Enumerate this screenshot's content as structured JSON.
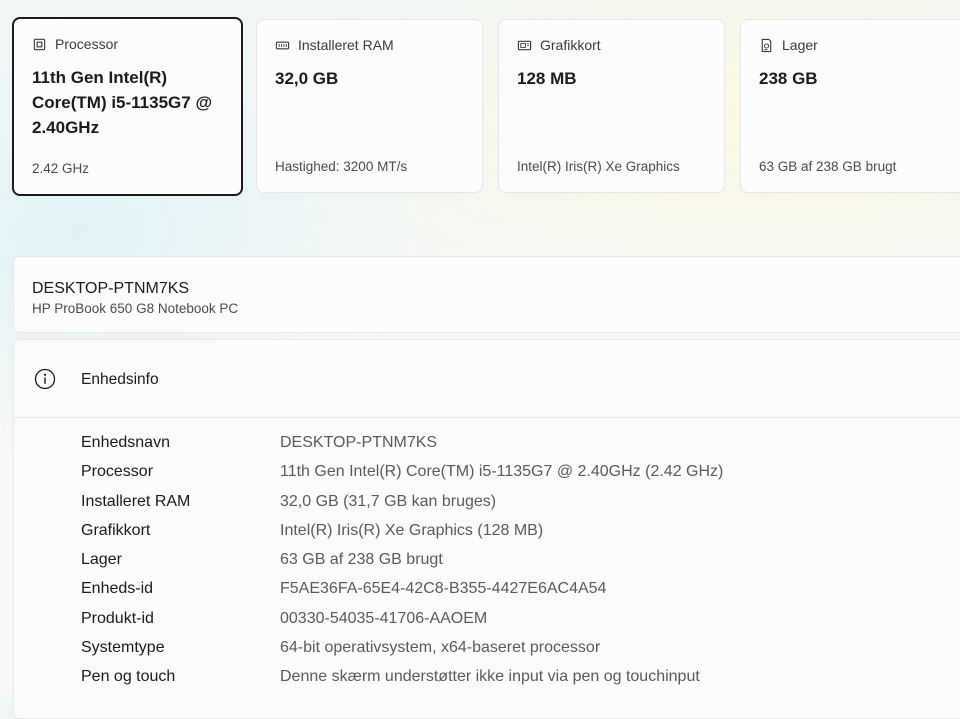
{
  "cards": [
    {
      "title": "Processor",
      "icon": "cpu-icon",
      "value": "11th Gen Intel(R) Core(TM) i5-1135G7 @ 2.40GHz",
      "sub": "2.42 GHz"
    },
    {
      "title": "Installeret RAM",
      "icon": "ram-icon",
      "value": "32,0 GB",
      "sub": "Hastighed: 3200 MT/s"
    },
    {
      "title": "Grafikkort",
      "icon": "gpu-icon",
      "value": "128 MB",
      "sub": "Intel(R) Iris(R) Xe Graphics"
    },
    {
      "title": "Lager",
      "icon": "storage-icon",
      "value": "238 GB",
      "sub": "63 GB af 238 GB brugt"
    }
  ],
  "device": {
    "name": "DESKTOP-PTNM7KS",
    "model": "HP ProBook 650 G8 Notebook PC"
  },
  "info": {
    "title": "Enhedsinfo",
    "icon": "info-icon",
    "rows": [
      {
        "key": "Enhedsnavn",
        "value": "DESKTOP-PTNM7KS"
      },
      {
        "key": "Processor",
        "value": "11th Gen Intel(R) Core(TM) i5-1135G7 @ 2.40GHz (2.42 GHz)"
      },
      {
        "key": "Installeret RAM",
        "value": "32,0 GB (31,7 GB kan bruges)"
      },
      {
        "key": "Grafikkort",
        "value": "Intel(R) Iris(R) Xe Graphics (128 MB)"
      },
      {
        "key": "Lager",
        "value": "63 GB af 238 GB brugt"
      },
      {
        "key": "Enheds-id",
        "value": "F5AE36FA-65E4-42C8-B355-4427E6AC4A54"
      },
      {
        "key": "Produkt-id",
        "value": "00330-54035-41706-AAOEM"
      },
      {
        "key": "Systemtype",
        "value": "64-bit operativsystem, x64-baseret processor"
      },
      {
        "key": "Pen og touch",
        "value": "Denne skærm understøtter ikke input via pen og touchinput"
      }
    ]
  }
}
